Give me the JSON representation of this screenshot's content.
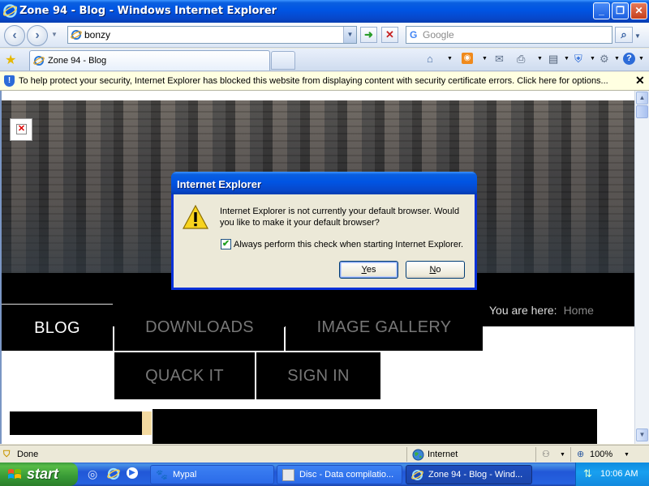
{
  "window": {
    "title": "Zone 94 - Blog - Windows Internet Explorer",
    "minimize": "_",
    "restore": "❐",
    "close": "✕"
  },
  "address": {
    "value": "bonzy",
    "search_placeholder": "Google"
  },
  "tabs": [
    {
      "label": "Zone 94 - Blog"
    }
  ],
  "infobar": {
    "message": "To help protect your security, Internet Explorer has blocked this website from displaying content with security certificate errors. Click here for options...",
    "close": "✕"
  },
  "site": {
    "nav": [
      "BLOG",
      "DOWNLOADS",
      "IMAGE GALLERY",
      "QUACK IT",
      "SIGN IN"
    ],
    "breadcrumb_prefix": "You are here:",
    "breadcrumb_home": "Home"
  },
  "dialog": {
    "title": "Internet Explorer",
    "message": "Internet Explorer is not currently your default browser. Would you like to make it your default browser?",
    "checkbox_label": "Always perform this check when starting Internet Explorer.",
    "checkbox_checked": true,
    "yes": "Yes",
    "no": "No"
  },
  "status": {
    "left": "Done",
    "zone": "Internet",
    "zoom": "100%"
  },
  "taskbar": {
    "start": "start",
    "items": [
      {
        "label": "Mypal"
      },
      {
        "label": "Disc - Data compilatio..."
      },
      {
        "label": "Zone 94 - Blog - Wind..."
      }
    ],
    "clock": "10:06 AM"
  },
  "colors": {
    "xp_blue": "#0054e3",
    "start_green": "#389a36",
    "infobar_bg": "#ffffe1"
  },
  "icons": [
    "ie-icon",
    "back-icon",
    "forward-icon",
    "refresh-icon",
    "stop-icon",
    "search-icon",
    "favorites-star-icon",
    "home-icon",
    "rss-icon",
    "print-icon",
    "page-icon",
    "safety-icon",
    "tools-icon",
    "help-icon",
    "shield-icon",
    "warning-icon",
    "globe-icon",
    "windows-flag-icon"
  ]
}
